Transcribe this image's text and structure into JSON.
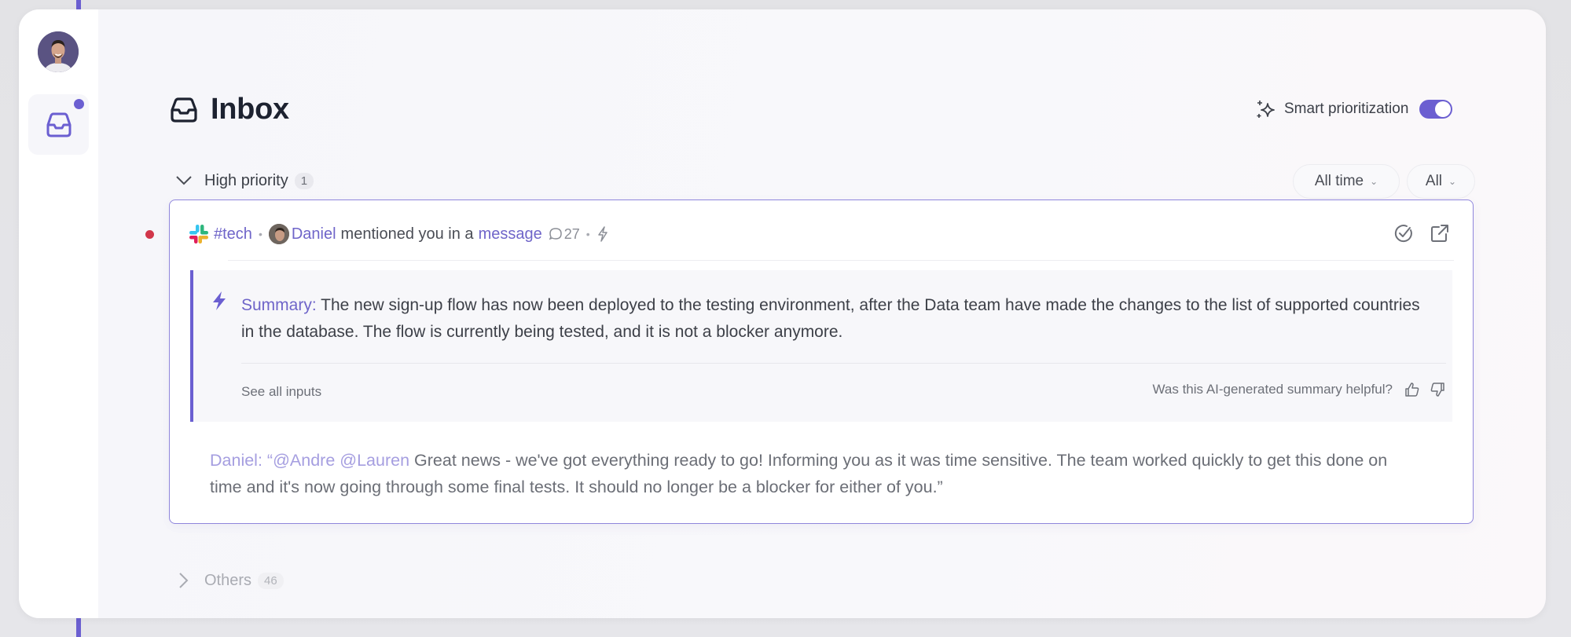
{
  "app": {
    "colors": {
      "accent": "#6b5fd1",
      "unread": "#d1364a",
      "link": "#6f65c9"
    }
  },
  "sidebar": {
    "avatar": {
      "alt": "user-avatar"
    },
    "items": [
      {
        "name": "inbox",
        "icon": "inbox-icon",
        "active": true,
        "has_notification": true
      }
    ]
  },
  "header": {
    "title": "Inbox",
    "title_icon": "inbox-icon",
    "smart_prioritization": {
      "label": "Smart prioritization",
      "icon": "sparkles-icon",
      "enabled": true
    }
  },
  "sections": [
    {
      "label": "High priority",
      "count": "1",
      "expanded": true,
      "filters": [
        {
          "label": "All time",
          "icon": "chevron-down-icon"
        },
        {
          "label": "All",
          "icon": "chevron-down-icon"
        }
      ],
      "items": [
        {
          "unread": true,
          "source_icon": "slack-icon",
          "channel": "#tech",
          "separator": "•",
          "author": "Daniel",
          "action_text": "mentioned you in a",
          "link_text": "message",
          "comment_count": "27",
          "priority_icon": "lightning-icon",
          "actions": [
            "mark-done",
            "open-external"
          ],
          "summary": {
            "label": "Summary:",
            "text": "The new sign-up flow has now been deployed to the testing environment, after the Data team have made the changes to the list of supported countries in the database. The flow is currently being tested, and it is not a blocker anymore.",
            "see_all_label": "See all inputs",
            "feedback_prompt": "Was this AI-generated summary helpful?"
          },
          "message": {
            "author_label": "Daniel:",
            "open_quote": "“",
            "mentions": "@Andre @Lauren",
            "text": "Great news - we've got everything ready to go! Informing you as it was time sensitive. The team worked quickly to get this done on time and it's now going through some final tests. It should no longer be a blocker for either of you.”"
          }
        }
      ]
    },
    {
      "label": "Others",
      "count": "46",
      "expanded": false
    }
  ]
}
